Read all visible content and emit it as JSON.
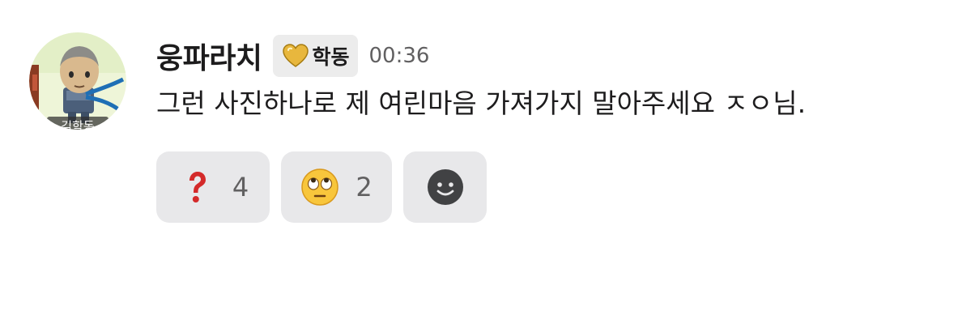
{
  "message": {
    "username": "웅파라치",
    "badge": {
      "icon": "gold-heart-icon",
      "label": "학동"
    },
    "timestamp": "00:36",
    "text": "그런 사진하나로 제 여린마음 가져가지 말아주세요 ㅈㅇ님.",
    "avatar_caption": "김학동"
  },
  "reactions": [
    {
      "emoji": "red-question-mark-icon",
      "count": "4"
    },
    {
      "emoji": "face-with-rolling-eyes-icon",
      "count": "2"
    },
    {
      "emoji": "add-reaction-icon"
    }
  ]
}
